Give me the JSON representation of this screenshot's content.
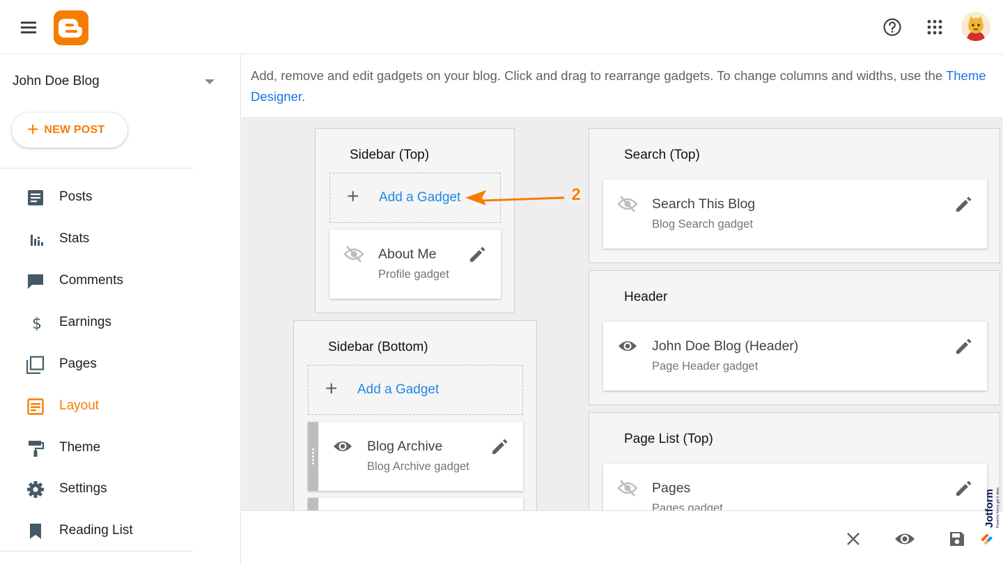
{
  "topbar": {
    "menu_icon": "hamburger-menu-icon",
    "logo": "blogger-logo",
    "help_icon": "help-circle-icon",
    "apps_icon": "apps-grid-icon",
    "avatar": "user-avatar"
  },
  "sidebar": {
    "blog_name": "John Doe Blog",
    "new_post_label": "NEW POST",
    "items": [
      {
        "label": "Posts",
        "icon": "posts-icon",
        "active": false
      },
      {
        "label": "Stats",
        "icon": "stats-icon",
        "active": false
      },
      {
        "label": "Comments",
        "icon": "comments-icon",
        "active": false
      },
      {
        "label": "Earnings",
        "icon": "dollar-icon",
        "active": false
      },
      {
        "label": "Pages",
        "icon": "pages-icon",
        "active": false
      },
      {
        "label": "Layout",
        "icon": "layout-icon",
        "active": true
      },
      {
        "label": "Theme",
        "icon": "paint-roller-icon",
        "active": false
      },
      {
        "label": "Settings",
        "icon": "gear-icon",
        "active": false
      },
      {
        "label": "Reading List",
        "icon": "bookmark-icon",
        "active": false
      }
    ]
  },
  "main": {
    "intro_text": "Add, remove and edit gadgets on your blog. Click and drag to rearrange gadgets. To change columns and widths, use the",
    "intro_link": "Theme Designer",
    "intro_end": ".",
    "add_gadget_label": "Add a Gadget",
    "sections": {
      "sidebar_top": {
        "title": "Sidebar (Top)",
        "gadgets": [
          {
            "title": "About Me",
            "subtitle": "Profile gadget",
            "visible": false
          }
        ]
      },
      "sidebar_bottom": {
        "title": "Sidebar (Bottom)",
        "gadgets": [
          {
            "title": "Blog Archive",
            "subtitle": "Blog Archive gadget",
            "visible": true
          }
        ]
      },
      "search_top": {
        "title": "Search (Top)",
        "gadgets": [
          {
            "title": "Search This Blog",
            "subtitle": "Blog Search gadget",
            "visible": false
          }
        ]
      },
      "header": {
        "title": "Header",
        "gadgets": [
          {
            "title": "John Doe Blog (Header)",
            "subtitle": "Page Header gadget",
            "visible": true
          }
        ]
      },
      "page_list_top": {
        "title": "Page List (Top)",
        "gadgets": [
          {
            "title": "Pages",
            "subtitle": "Pages gadget",
            "visible": false
          }
        ]
      }
    }
  },
  "bottombar": {
    "close_icon": "close-icon",
    "preview_icon": "eye-icon",
    "save_icon": "save-icon"
  },
  "annotation": {
    "step_number": "2"
  },
  "watermark": {
    "brand": "Jotform",
    "tagline": "Powerful forms get it done."
  },
  "colors": {
    "accent": "#f57d00",
    "link": "#1a73e8",
    "gadget_link": "#1e88e5"
  }
}
